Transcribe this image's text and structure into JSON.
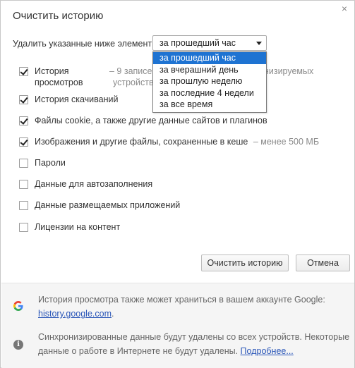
{
  "dialog": {
    "title": "Очистить историю",
    "close_glyph": "×"
  },
  "range": {
    "label": "Удалить указанные ниже элементы",
    "selected": "за прошедший час",
    "options": [
      "за прошедший час",
      "за вчерашний день",
      "за прошлую неделю",
      "за последние 4 недели",
      "за все время"
    ]
  },
  "items": {
    "history_line1": "История",
    "history_line2": "просмотров",
    "history_desc1": "–  9 записе",
    "history_desc2": "устройства",
    "history_desc1_tail": "онизируемых",
    "downloads": "История скачиваний",
    "cookies": "Файлы cookie, а также другие данные сайтов и плагинов",
    "cache": "Изображения и другие файлы, сохраненные в кеше",
    "cache_desc": "–  менее 500 МБ",
    "passwords": "Пароли",
    "autofill": "Данные для автозаполнения",
    "hosted_apps": "Данные размещаемых приложений",
    "licenses": "Лицензии на контент"
  },
  "buttons": {
    "clear": "Очистить историю",
    "cancel": "Отмена"
  },
  "footer": {
    "google_text": "История просмотра также может храниться в вашем аккаунте Google:",
    "google_link": "history.google.com",
    "google_link_suffix": ".",
    "sync_text_1": "Синхронизированные данные будут удалены со всех устройств. Некоторые",
    "sync_text_2": "данные о работе в Интернете не будут удалены. ",
    "sync_link": "Подробнее..."
  },
  "colors": {
    "selected_option": "#1e73d2",
    "link": "#2a56b8",
    "footer_bg": "#f5f5f5"
  }
}
